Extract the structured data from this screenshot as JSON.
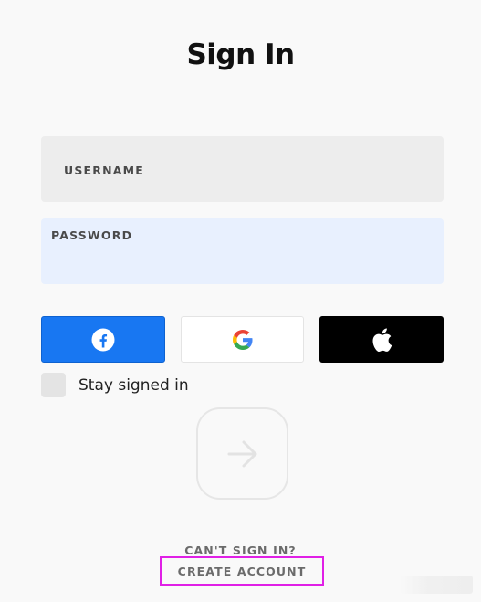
{
  "header": {
    "title": "Sign In"
  },
  "form": {
    "username": {
      "label": "USERNAME",
      "value": ""
    },
    "password": {
      "label": "PASSWORD",
      "value": ""
    },
    "stay_signed_in": {
      "label": "Stay signed in",
      "checked": false
    }
  },
  "social": {
    "facebook": {
      "icon": "facebook-icon",
      "color": "#1877f2"
    },
    "google": {
      "icon": "google-icon",
      "color": "#ffffff"
    },
    "apple": {
      "icon": "apple-icon",
      "color": "#000000"
    }
  },
  "submit": {
    "icon": "arrow-right-icon"
  },
  "links": {
    "cant_sign_in": "CAN'T SIGN IN?",
    "create_account": "CREATE ACCOUNT"
  },
  "colors": {
    "background": "#f9f9f9",
    "username_field": "#ededed",
    "password_field": "#e8f0fe",
    "highlight_border": "#e020e6"
  }
}
